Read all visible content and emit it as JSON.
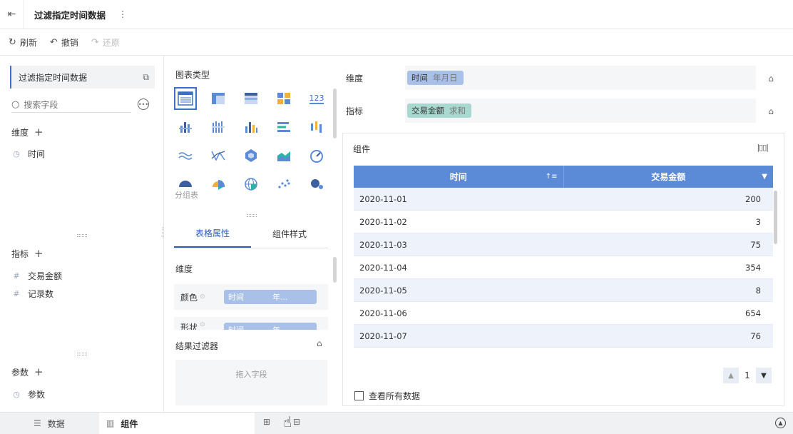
{
  "header": {
    "title": "过滤指定时间数据"
  },
  "toolbar": {
    "refresh": "刷新",
    "undo": "撤销",
    "redo": "还原"
  },
  "left": {
    "dataset": "过滤指定时间数据",
    "search_placeholder": "搜索字段",
    "dimensions_label": "维度",
    "dimensions": [
      "时间"
    ],
    "measures_label": "指标",
    "measures": [
      "交易金额",
      "记录数"
    ],
    "params_label": "参数",
    "params": [
      "参数"
    ]
  },
  "middle": {
    "chart_types_label": "图表类型",
    "chart_type_hover": "分组表",
    "tabs": [
      "表格属性",
      "组件样式"
    ],
    "props_dim_label": "维度",
    "color_label": "颜色",
    "shape_label": "形状",
    "color_pill": {
      "field": "时间",
      "sub": "年..."
    },
    "shape_pill": {
      "field": "时间",
      "sub": "年..."
    },
    "result_filter_label": "结果过滤器",
    "drop_hint": "拖入字段"
  },
  "shelves": {
    "dim_label": "维度",
    "dim_pill": {
      "field": "时间",
      "agg": "年月日"
    },
    "measure_label": "指标",
    "measure_pill": {
      "field": "交易金额",
      "agg": "求和"
    }
  },
  "widget": {
    "title": "组件",
    "columns": [
      "时间",
      "交易金额"
    ],
    "rows": [
      {
        "date": "2020-11-01",
        "amount": "200"
      },
      {
        "date": "2020-11-02",
        "amount": "3"
      },
      {
        "date": "2020-11-03",
        "amount": "75"
      },
      {
        "date": "2020-11-04",
        "amount": "354"
      },
      {
        "date": "2020-11-05",
        "amount": "8"
      },
      {
        "date": "2020-11-06",
        "amount": "654"
      },
      {
        "date": "2020-11-07",
        "amount": "76"
      }
    ],
    "page": "1",
    "view_all": "查看所有数据"
  },
  "bottom": {
    "data_tab": "数据",
    "widget_tab": "组件"
  },
  "colors": {
    "accent": "#2a5cb8",
    "header_blue": "#5b8ad6",
    "dim_pill": "#a9c0e8",
    "measure_pill": "#a8d8cf"
  }
}
